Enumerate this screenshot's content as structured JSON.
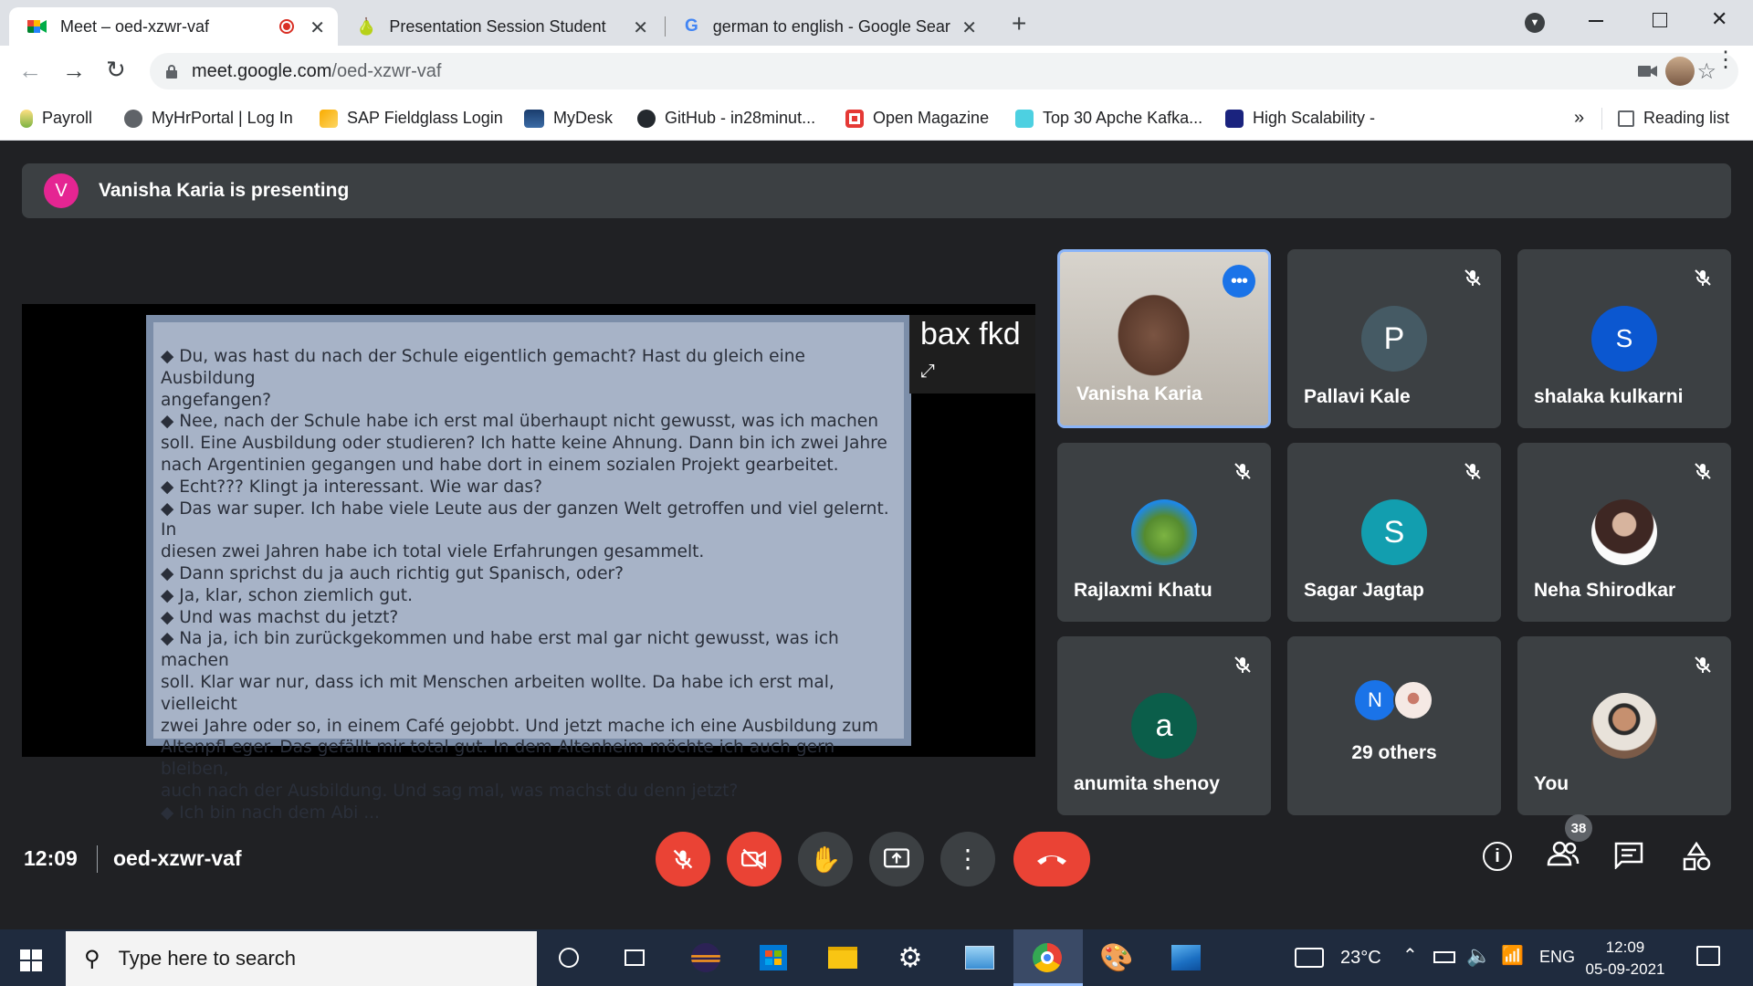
{
  "browser": {
    "tabs": [
      {
        "title": "Meet – oed-xzwr-vaf",
        "recording": true
      },
      {
        "title": "Presentation Session Student"
      },
      {
        "title": "german to english - Google Sear"
      }
    ],
    "url_host": "meet.google.com",
    "url_path": "/oed-xzwr-vaf",
    "bookmarks": [
      "Payroll",
      "MyHrPortal | Log In",
      "SAP Fieldglass Login",
      "MyDesk",
      "GitHub - in28minut...",
      "Open Magazine",
      "Top 30 Apche Kafka...",
      "High Scalability -"
    ],
    "overflow": "»",
    "reading_list": "Reading list"
  },
  "meet": {
    "banner": {
      "avatar": "V",
      "text": "Vanisha Karia is presenting"
    },
    "presenter_label": "bax fkd",
    "slide_lines": [
      "◆ Du, was hast du nach der Schule eigentlich gemacht? Hast du gleich eine Ausbildung",
      "angefangen?",
      "◆ Nee, nach der Schule habe ich erst mal überhaupt nicht gewusst, was ich machen",
      "soll. Eine Ausbildung oder studieren? Ich hatte keine Ahnung. Dann bin ich zwei Jahre",
      "nach Argentinien gegangen und habe dort in einem sozialen Projekt gearbeitet.",
      "◆ Echt??? Klingt ja interessant. Wie war das?",
      "◆ Das war super. Ich habe viele Leute aus der ganzen Welt getroffen und viel gelernt. In",
      "diesen zwei Jahren habe ich total viele Erfahrungen gesammelt.",
      "◆ Dann sprichst du ja auch richtig gut Spanisch, oder?",
      "◆ Ja, klar, schon ziemlich gut.",
      "◆ Und was machst du jetzt?",
      "◆ Na ja, ich bin zurückgekommen und habe erst mal gar nicht gewusst, was ich machen",
      "soll. Klar war nur, dass ich mit Menschen arbeiten wollte. Da habe ich erst mal, vielleicht",
      "zwei Jahre oder so, in einem Café gejobbt. Und jetzt mache ich eine Ausbildung zum",
      "Altenpfl eger. Das gefällt mir total gut. In dem Altenheim möchte ich auch gern bleiben,",
      "auch nach der Ausbildung. Und sag mal, was machst du denn jetzt?",
      "◆ Ich bin nach dem Abi ..."
    ],
    "participants": [
      {
        "name": "Vanisha Karia",
        "type": "video"
      },
      {
        "name": "Pallavi Kale",
        "initial": "P",
        "color": "#455a64"
      },
      {
        "name": "shalaka kulkarni",
        "initial": "S",
        "color": "#0b57d0"
      },
      {
        "name": "Rajlaxmi Khatu",
        "type": "photo"
      },
      {
        "name": "Sagar Jagtap",
        "initial": "S",
        "color": "#129eaf"
      },
      {
        "name": "Neha Shirodkar",
        "type": "photo"
      },
      {
        "name": "anumita shenoy",
        "initial": "a",
        "color": "#0b5e4a"
      },
      {
        "name": "29 others",
        "initial": "N",
        "color": "#1a73e8"
      },
      {
        "name": "You",
        "type": "photo"
      }
    ],
    "clock": "12:09",
    "meeting_code": "oed-xzwr-vaf",
    "people_count": "38"
  },
  "taskbar": {
    "search_placeholder": "Type here to search",
    "weather": "23°C",
    "language": "ENG",
    "time": "12:09",
    "date": "05-09-2021"
  }
}
